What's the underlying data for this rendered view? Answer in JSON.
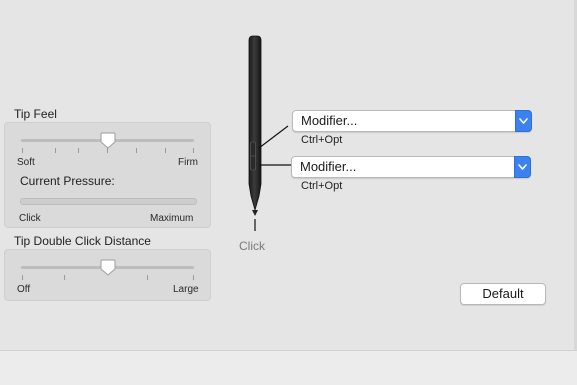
{
  "tip_feel": {
    "title": "Tip Feel",
    "min_label": "Soft",
    "max_label": "Firm",
    "value_fraction": 0.5,
    "current_pressure_label": "Current Pressure:",
    "pressure_min_label": "Click",
    "pressure_max_label": "Maximum"
  },
  "double_click": {
    "title": "Tip Double Click Distance",
    "min_label": "Off",
    "max_label": "Large",
    "value_fraction": 0.5
  },
  "pen": {
    "tip_label": "Click",
    "upper_button": {
      "value": "Modifier...",
      "sub_label": "Ctrl+Opt"
    },
    "lower_button": {
      "value": "Modifier...",
      "sub_label": "Ctrl+Opt"
    }
  },
  "default_button_label": "Default",
  "colors": {
    "accent": "#3b82f0",
    "background": "#e5e5e5"
  }
}
